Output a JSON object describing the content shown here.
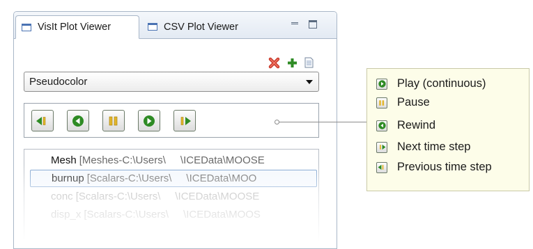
{
  "tabs": [
    {
      "label": "VisIt Plot Viewer",
      "active": true
    },
    {
      "label": "CSV Plot Viewer",
      "active": false
    }
  ],
  "plot_type": {
    "selected": "Pseudocolor"
  },
  "controls": [
    "previous-time-step",
    "rewind",
    "pause",
    "play",
    "next-time-step"
  ],
  "plots": [
    {
      "name": "Mesh",
      "detail": "[Meshes-C:\\Users\\       \\ICEData\\MOOSE",
      "selected": false
    },
    {
      "name": "burnup",
      "detail": "[Scalars-C:\\Users\\       \\ICEData\\MOO",
      "selected": true
    },
    {
      "name": "conc",
      "detail": "[Scalars-C:\\Users\\       \\ICEData\\MOOSE",
      "selected": false
    },
    {
      "name": "disp_x",
      "detail": "[Scalars-C:\\Users\\       \\ICEData\\MOOS",
      "selected": false
    }
  ],
  "legend": {
    "items": [
      {
        "icon": "play-icon",
        "label": "Play (continuous)"
      },
      {
        "icon": "pause-icon",
        "label": "Pause"
      },
      {
        "icon": "rewind-icon",
        "label": "Rewind"
      },
      {
        "icon": "next-step-icon",
        "label": "Next time step"
      },
      {
        "icon": "previous-step-icon",
        "label": "Previous time step"
      }
    ]
  },
  "colors": {
    "accent_green": "#2e8b24",
    "delete_red": "#d23a2a",
    "callout_bg": "#fdfde9",
    "selection_border": "#7da2ce"
  }
}
